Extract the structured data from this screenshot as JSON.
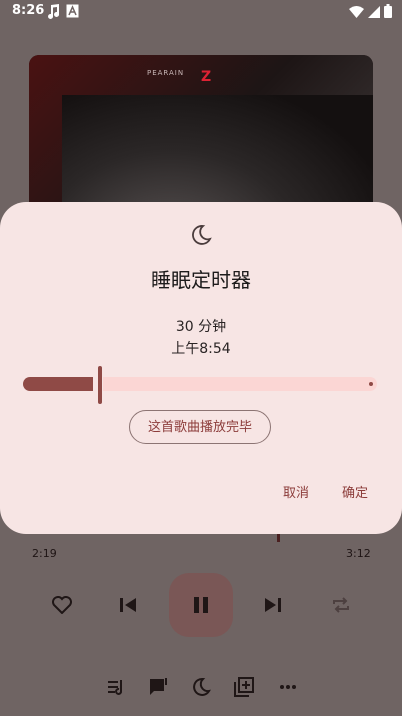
{
  "status_bar": {
    "time": "8:26",
    "icons": [
      "music-note-icon",
      "font-a-icon",
      "wifi-icon",
      "cellular-signal-icon",
      "battery-icon"
    ]
  },
  "album": {
    "brand_text": "PEARAIN",
    "brand_mark": "Z"
  },
  "sleep_timer_dialog": {
    "icon": "moon-icon",
    "title": "睡眠定时器",
    "minutes_label": "30 分钟",
    "end_time_label": "上午8:54",
    "slider_fraction": 0.2,
    "finish_song_button": "这首歌曲播放完毕",
    "cancel_button": "取消",
    "confirm_button": "确定"
  },
  "player": {
    "current_time": "2:19",
    "total_time": "3:12",
    "controls": [
      "heart-icon",
      "skip-previous-icon",
      "pause-icon",
      "skip-next-icon",
      "repeat-icon"
    ],
    "bottom_actions": [
      "queue-icon",
      "lyrics-icon",
      "moon-icon",
      "add-to-playlist-icon",
      "more-icon"
    ]
  },
  "colors": {
    "dialog_background": "#f7e5e4",
    "accent": "#8f4a46",
    "scrim": "#6f6463"
  }
}
